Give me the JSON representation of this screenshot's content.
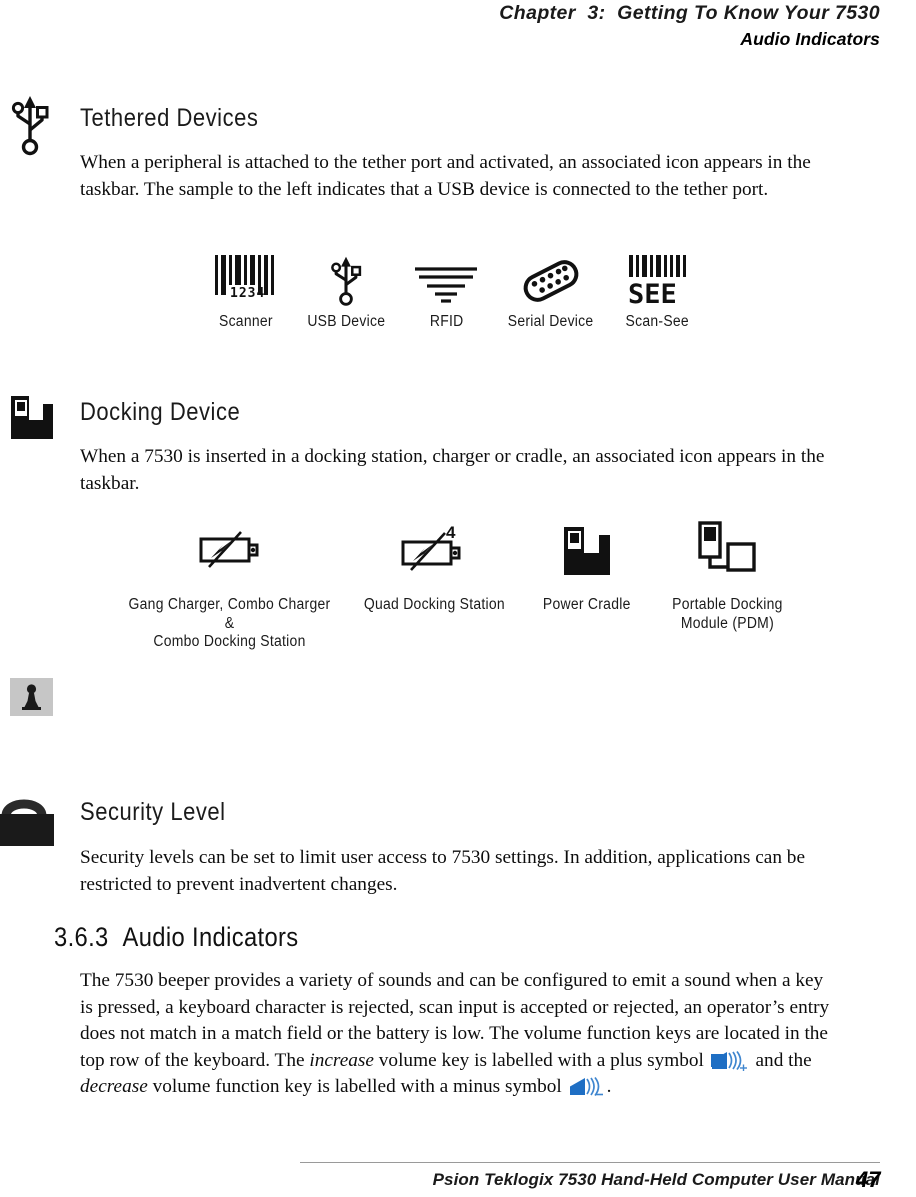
{
  "header": {
    "chapter_line": "Chapter  3:  Getting To Know Your 7530",
    "section_line": "Audio Indicators"
  },
  "sections": [
    {
      "id": "tethered-devices",
      "margin_icon": "usb-icon",
      "heading": "Tethered Devices",
      "paragraph": "When a peripheral is attached to the tether port and activated, an associated icon appears in the taskbar. The sample to the left indicates that a USB device is connected to the tether port.",
      "icons": [
        {
          "icon": "barcode-scanner-icon",
          "label": "Scanner"
        },
        {
          "icon": "usb-device-icon",
          "label": "USB Device"
        },
        {
          "icon": "rfid-icon",
          "label": "RFID"
        },
        {
          "icon": "serial-device-icon",
          "label": "Serial Device"
        },
        {
          "icon": "scan-see-icon",
          "label": "Scan-See"
        }
      ]
    },
    {
      "id": "docking-device",
      "margin_icon": "docking-device-icon",
      "heading": "Docking Device",
      "paragraph": "When a 7530 is inserted in a docking station, charger or cradle, an associated icon appears in the taskbar.",
      "icons": [
        {
          "icon": "battery-charger-icon",
          "label": "Gang Charger, Combo Charger &\nCombo Docking Station"
        },
        {
          "icon": "quad-docking-icon",
          "label": "Quad Docking Station",
          "badge": "4"
        },
        {
          "icon": "power-cradle-icon",
          "label": "Power Cradle"
        },
        {
          "icon": "portable-docking-module-icon",
          "label": "Portable Docking\nModule (PDM)"
        }
      ]
    },
    {
      "id": "security-level",
      "margin_icon": "padlock-icon",
      "secondary_margin_icon": "chess-pawn-icon",
      "heading": "Security Level",
      "paragraph": "Security levels can be set to limit user access to 7530 settings. In addition, applications can be restricted to prevent inadvertent changes."
    }
  ],
  "audio_section": {
    "number": "3.6.3",
    "title": "Audio Indicators",
    "paragraph_part1": "The 7530 beeper provides a variety of sounds and can be configured to emit a sound when a key is pressed, a keyboard character is rejected, scan input is accepted or rejected, an operator’s entry does not match in a match field or the battery is low. The volume function keys are located in the top row of the keyboard. The ",
    "increase_word": "increase",
    "paragraph_part2": " volume key is labelled with a plus symbol ",
    "paragraph_part3": " and the ",
    "decrease_word": "decrease",
    "paragraph_part4": " volume function key is labelled with a minus symbol ",
    "paragraph_part5": ".",
    "volume_up_icon": "speaker-plus-icon",
    "volume_down_icon": "speaker-minus-icon"
  },
  "footer": {
    "manual_title": "Psion Teklogix 7530 Hand-Held Computer User Manual",
    "page_number": "47"
  },
  "colors": {
    "speaker_blue": "#1f6fc4",
    "text_black": "#0d0d0d",
    "pawn_background": "#c6c6c6",
    "rule_gray": "#9a9a9a"
  }
}
